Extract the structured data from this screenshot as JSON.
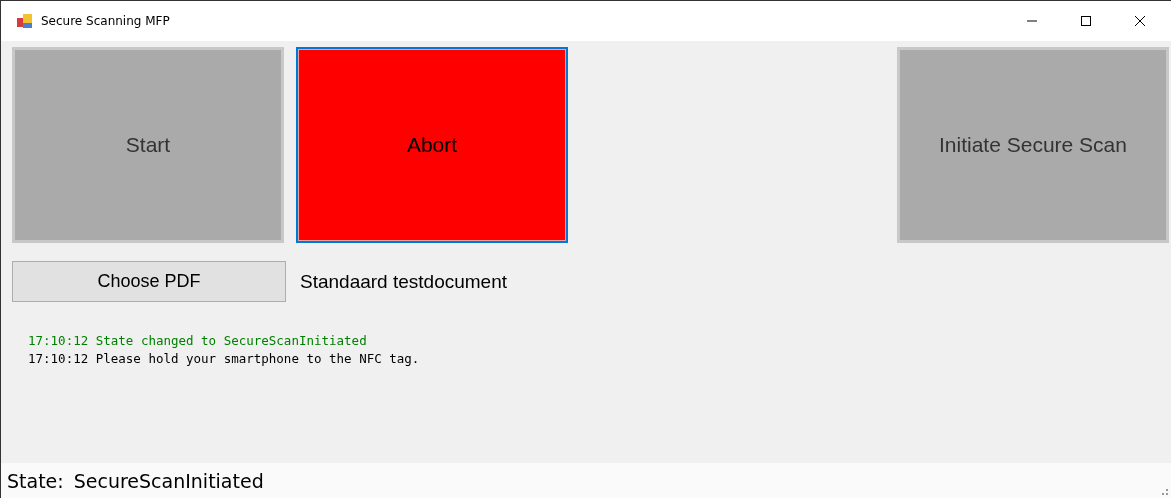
{
  "window": {
    "title": "Secure Scanning MFP"
  },
  "action_buttons": [
    {
      "label": "Start",
      "color": "#aaaaaa",
      "focused": false
    },
    {
      "label": "Abort",
      "color": "#ff0000",
      "focused": true
    },
    {
      "label": "Initiate Secure Scan",
      "color": "#aaaaaa",
      "focused": false
    }
  ],
  "file_button": {
    "label": "Choose PDF"
  },
  "file_name": "Standaard testdocument",
  "log": [
    {
      "text": "17:10:12 State changed to SecureScanInitiated",
      "color": "#008000"
    },
    {
      "text": "17:10:12 Please hold your smartphone to the NFC tag.",
      "color": "#000000"
    }
  ],
  "status_bar": {
    "label": "State:",
    "value": "SecureScanInitiated"
  }
}
